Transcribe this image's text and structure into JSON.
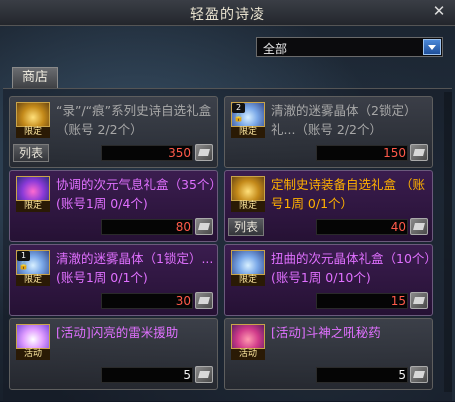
{
  "window": {
    "title": "轻盈的诗凌",
    "close_icon": "close-icon"
  },
  "filter": {
    "selected": "全部"
  },
  "tabs": {
    "shop": "商店"
  },
  "items": [
    {
      "name": "“录”/“痕”系列史诗自选礼盒 （账号 2/2个）",
      "icon": "chest-icon",
      "badge": "限定",
      "lock": "",
      "show_list": true,
      "list_label": "列表",
      "price": "350",
      "name_color": "gray",
      "active": false,
      "price_white": false
    },
    {
      "name": "清澈的迷雾晶体（2锁定）礼...（账号 2/2个）",
      "icon": "crystal-icon",
      "badge": "限定",
      "lock": "2🔒",
      "show_list": false,
      "list_label": "",
      "price": "150",
      "name_color": "gray",
      "active": false,
      "price_white": false
    },
    {
      "name": "协调的次元气息礼盒（35个）(账号1周 0/4个)",
      "icon": "swirl-icon",
      "badge": "限定",
      "lock": "",
      "show_list": false,
      "list_label": "",
      "price": "80",
      "name_color": "purple",
      "active": true,
      "price_white": false
    },
    {
      "name": "定制史诗装备自选礼盒 （账号1周 0/1个）",
      "icon": "chest-icon",
      "badge": "限定",
      "lock": "",
      "show_list": true,
      "list_label": "列表",
      "price": "40",
      "name_color": "orange",
      "active": true,
      "price_white": false
    },
    {
      "name": "清澈的迷雾晶体（1锁定）...(账号1周 0/1个)",
      "icon": "crystal-icon",
      "badge": "限定",
      "lock": "1🔒",
      "show_list": false,
      "list_label": "",
      "price": "30",
      "name_color": "purple",
      "active": true,
      "price_white": false
    },
    {
      "name": "扭曲的次元晶体礼盒（10个）(账号1周 0/10个)",
      "icon": "crystal-icon",
      "badge": "限定",
      "lock": "",
      "show_list": false,
      "list_label": "",
      "price": "15",
      "name_color": "purple",
      "active": true,
      "price_white": false
    },
    {
      "name": "[活动]闪亮的雷米援助",
      "icon": "light-icon",
      "badge": "活动",
      "lock": "",
      "show_list": false,
      "list_label": "",
      "price": "5",
      "name_color": "purple",
      "active": false,
      "price_white": true
    },
    {
      "name": "[活动]斗神之吼秘药",
      "icon": "potion-icon",
      "badge": "活动",
      "lock": "",
      "show_list": false,
      "list_label": "",
      "price": "5",
      "name_color": "purple",
      "active": false,
      "price_white": true
    }
  ]
}
